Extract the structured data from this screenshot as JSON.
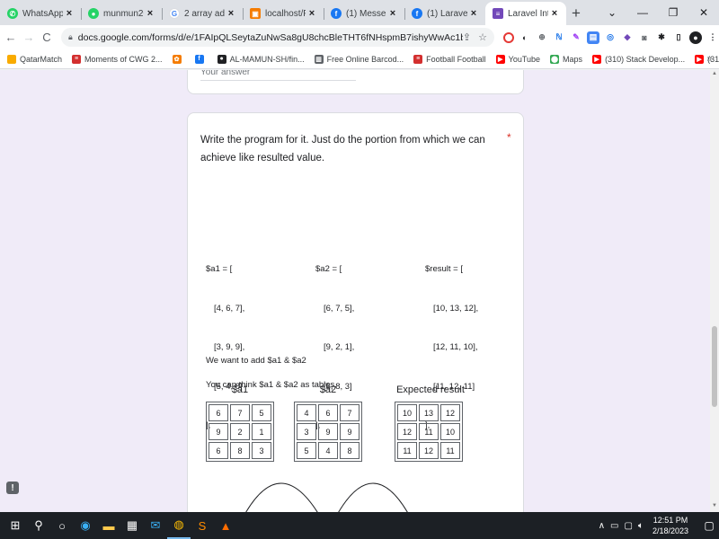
{
  "browser": {
    "tabs": [
      {
        "title": "WhatsApp",
        "icon": "whatsapp-icon",
        "color": "#25d366",
        "glyph": "✆"
      },
      {
        "title": "munmun20023 |",
        "icon": "github-icon",
        "color": "#25d366",
        "glyph": "●"
      },
      {
        "title": "2 array adddition",
        "icon": "google-icon",
        "color": "#ffffff",
        "glyph": "G"
      },
      {
        "title": "localhost/PRACTI",
        "icon": "xampp-icon",
        "color": "#f57c00",
        "glyph": "▣"
      },
      {
        "title": "(1) Messenger | F",
        "icon": "facebook-icon",
        "color": "#1877f2",
        "glyph": "f"
      },
      {
        "title": "(1) Laravel Bangl",
        "icon": "facebook-icon",
        "color": "#1877f2",
        "glyph": "f"
      },
      {
        "title": "Laravel Intern",
        "icon": "google-forms-icon",
        "color": "#7248b9",
        "glyph": "≡"
      }
    ],
    "new_tab_label": "+",
    "url": "docs.google.com/forms/d/e/1FAIpQLSeytaZuNwSa8gU8chcBleTHT6fNHspmB7ishyWwAc1bkl-ddg/viewform",
    "bookmarks": [
      {
        "label": "QatarMatch",
        "icon": "folder-icon",
        "color": "#f9ab00",
        "glyph": ""
      },
      {
        "label": "Moments of CWG 2...",
        "icon": "bookmark-icon",
        "color": "#d32f2f",
        "glyph": "≡"
      },
      {
        "label": "",
        "icon": "bookmark-icon",
        "color": "#f57c00",
        "glyph": "✿"
      },
      {
        "label": "",
        "icon": "facebook-icon",
        "color": "#1877f2",
        "glyph": "f"
      },
      {
        "label": "AL-MAMUN-SH/fin...",
        "icon": "github-icon",
        "color": "#202124",
        "glyph": "●"
      },
      {
        "label": "Free Online Barcod...",
        "icon": "barcode-icon",
        "color": "#5f6368",
        "glyph": "▥"
      },
      {
        "label": "Football Football",
        "icon": "bookmark-icon",
        "color": "#d32f2f",
        "glyph": "≡"
      },
      {
        "label": "YouTube",
        "icon": "youtube-icon",
        "color": "#ff0000",
        "glyph": "▶"
      },
      {
        "label": "Maps",
        "icon": "maps-icon",
        "color": "#34a853",
        "glyph": "⬤"
      },
      {
        "label": "(310) Stack Develop...",
        "icon": "youtube-icon",
        "color": "#ff0000",
        "glyph": "▶"
      },
      {
        "label": "(310) Laravel 9 Tuto...",
        "icon": "youtube-icon",
        "color": "#ff0000",
        "glyph": "▶"
      }
    ],
    "more_bookmarks": "»"
  },
  "form": {
    "prev_answer_hint": "Your answer",
    "question": "Write the program for it. Just do the portion from which we can achieve like resulted value.",
    "required_mark": "*",
    "code": {
      "a1": {
        "open": "$a1 = [",
        "rows": [
          "[4, 6, 7],",
          "[3, 9, 9],",
          "[5, 4, 8]"
        ],
        "close": "];"
      },
      "a2": {
        "open": "$a2 = [",
        "rows": [
          "[6, 7, 5],",
          "[9, 2, 1],",
          "[6, 8, 3]"
        ],
        "close": "];"
      },
      "result": {
        "open": "$result = [",
        "rows": [
          "[10, 13, 12],",
          "[12, 11, 10],",
          "[11, 12, 11]"
        ],
        "close": "];"
      }
    },
    "line1": "We want to add $a1 & $a2",
    "line2": "You can think $a1 & $a2 as tables.",
    "tables": [
      {
        "title": "$a1",
        "cells": [
          [
            "6",
            "7",
            "5"
          ],
          [
            "9",
            "2",
            "1"
          ],
          [
            "6",
            "8",
            "3"
          ]
        ]
      },
      {
        "title": "$a2",
        "cells": [
          [
            "4",
            "6",
            "7"
          ],
          [
            "3",
            "9",
            "9"
          ],
          [
            "5",
            "4",
            "8"
          ]
        ]
      },
      {
        "title": "Expected result",
        "cells": [
          [
            "10",
            "13",
            "12"
          ],
          [
            "12",
            "11",
            "10"
          ],
          [
            "11",
            "12",
            "11"
          ]
        ]
      }
    ]
  },
  "taskbar": {
    "time": "12:51 PM",
    "date": "2/18/2023"
  }
}
